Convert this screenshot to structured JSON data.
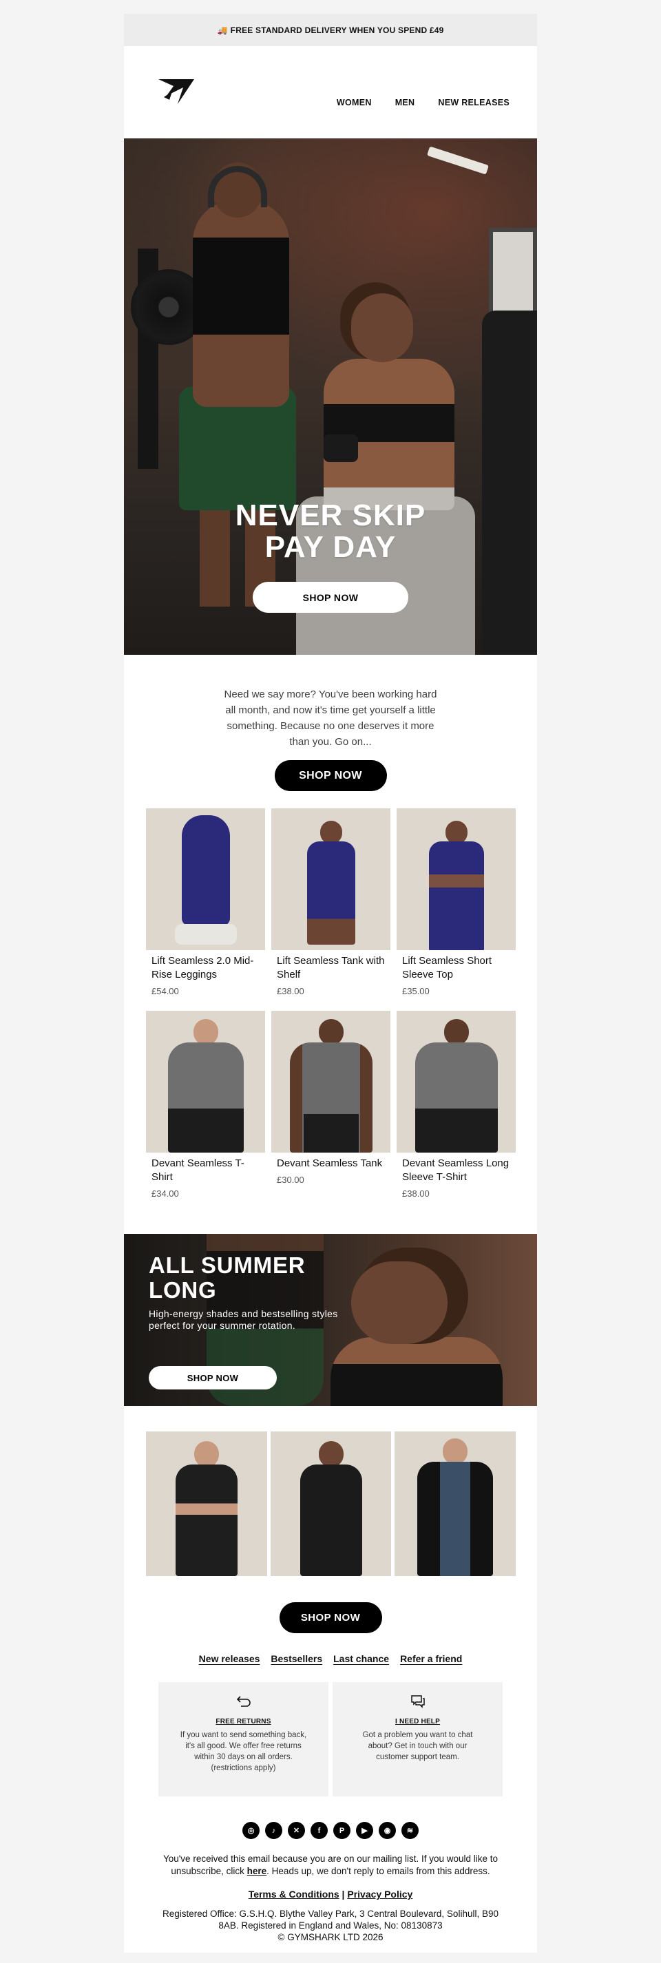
{
  "promo_bar": {
    "icon": "truck-icon",
    "text": "FREE STANDARD DELIVERY WHEN YOU SPEND £49"
  },
  "nav": {
    "women": "WOMEN",
    "men": "MEN",
    "new_releases": "NEW RELEASES"
  },
  "hero": {
    "title_line1": "NEVER SKIP",
    "title_line2": "PAY DAY",
    "cta": "SHOP NOW"
  },
  "intro": {
    "text": "Need we say more? You've been working hard all month, and now it's time get yourself a little something. Because no one deserves it more than you. Go on...",
    "cta": "SHOP NOW"
  },
  "products": [
    {
      "name": "Lift Seamless 2.0 Mid-Rise Leggings",
      "price": "£54.00"
    },
    {
      "name": "Lift Seamless Tank with Shelf",
      "price": "£38.00"
    },
    {
      "name": "Lift Seamless Short Sleeve Top",
      "price": "£35.00"
    },
    {
      "name": "Devant Seamless T-Shirt",
      "price": "£34.00"
    },
    {
      "name": "Devant Seamless Tank",
      "price": "£30.00"
    },
    {
      "name": "Devant Seamless Long Sleeve T-Shirt",
      "price": "£38.00"
    }
  ],
  "banner": {
    "title": "ALL SUMMER LONG",
    "subtitle": "High-energy shades and bestselling styles perfect for your summer rotation.",
    "cta": "SHOP NOW"
  },
  "cta_bottom": "SHOP NOW",
  "links": [
    "New releases",
    "Bestsellers",
    "Last chance",
    "Refer a friend"
  ],
  "info": [
    {
      "icon": "return-arrow-icon",
      "title": "FREE RETURNS",
      "text": "If you want to send something back, it's all good. We offer free returns within 30 days on all orders. (restrictions apply)"
    },
    {
      "icon": "chat-icon",
      "title": "I NEED HELP",
      "text": "Got a problem you want to chat about? Get in touch with our customer support team."
    }
  ],
  "social": [
    "instagram-icon",
    "tiktok-icon",
    "x-icon",
    "facebook-icon",
    "pinterest-icon",
    "youtube-icon",
    "discord-icon",
    "spotify-icon"
  ],
  "footer": {
    "text_before": "You've received this email because you are on our mailing list. If you would like to unsubscribe, click ",
    "here": "here",
    "text_after": ". Heads up, we don't reply to emails from this address.",
    "terms": "Terms & Conditions",
    "separator": " | ",
    "privacy": "Privacy Policy",
    "registered": "Registered Office: G.S.H.Q. Blythe Valley Park, 3 Central Boulevard, Solihull, B90 8AB. Registered in England and Wales, No: 08130873",
    "copyright": "© GYMSHARK LTD 2026"
  }
}
